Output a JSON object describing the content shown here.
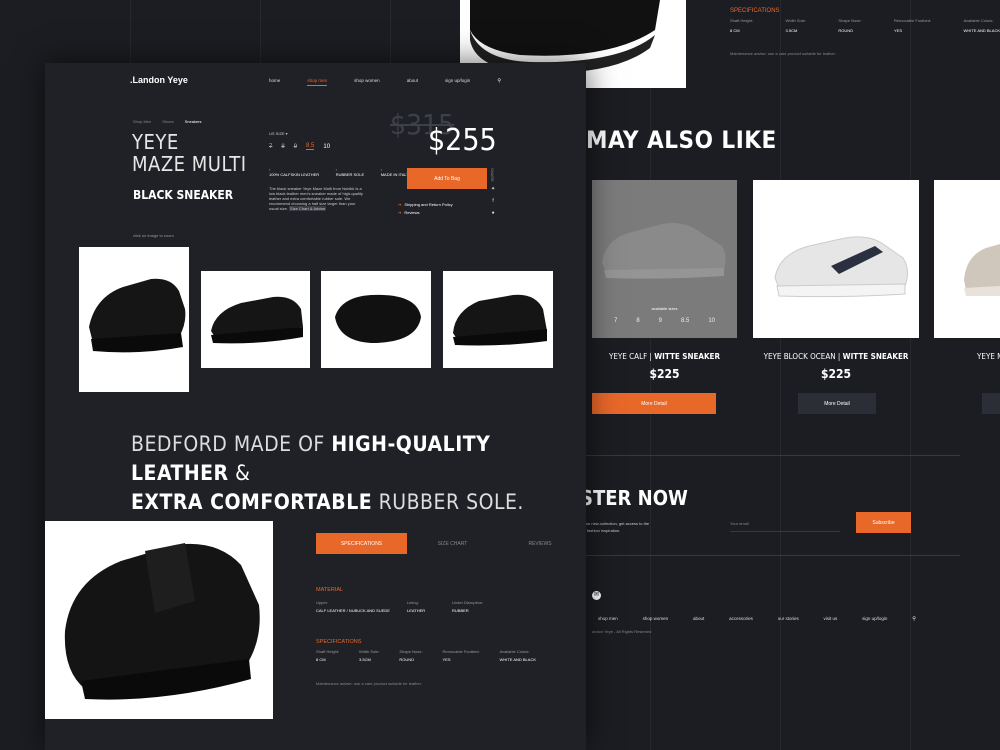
{
  "brand": ".Landon Yeye",
  "nav": {
    "home": "home",
    "shop_men": "shop men",
    "shop_women": "shop women",
    "about": "about",
    "signup": "sign up/login"
  },
  "breadcrumb": [
    "Shop Men",
    "Shoes",
    "Sneakers"
  ],
  "product": {
    "title_line1": "YEYE",
    "title_line2": "MAZE MULTI",
    "subtitle": "BLACK SNEAKER",
    "old_price": "$315",
    "price": "$255",
    "size_label": "US SIZE",
    "sizes": [
      "7",
      "8",
      "9",
      "8.5",
      "10"
    ],
    "features": [
      "100% CALFSKIN LEATHER",
      "RUBBER SOLE",
      "MADE IN ITALY"
    ],
    "description": "The black sneaker Yeye Maze Multi from Nubikk is a low black leather men's sneaker made of high-quality leather and extra comfortable rubber sole.",
    "size_advice": "We recommend choosing a half size larger than your usual size.",
    "size_chart_link": "Size Chart & Advise",
    "add_to_bag": "Add To Bag",
    "shipping_link": "Shipping and Return Policy",
    "reviews_link": "Reviews",
    "share_label": "SHARE",
    "zoom_hint": "click on image to zoom"
  },
  "headline": {
    "l1a": "BEDFORD MADE OF ",
    "l1b": "HIGH-QUALITY LEATHER",
    "l1c": " &",
    "l2a": "EXTRA COMFORTABLE",
    "l2b": " RUBBER SOLE."
  },
  "tabs": [
    "SPECIFICATIONS",
    "SIZE CHART",
    "REVIEWS"
  ],
  "material": {
    "title": "MATERIAL",
    "labels": [
      "Upper:",
      "Lining:",
      "Under Disruption:"
    ],
    "values": [
      "CALF LEATHER / NUBUCK AND SUEDE",
      "LEATHER",
      "RUBBER"
    ]
  },
  "specs": {
    "title": "SPECIFICATIONS",
    "labels": [
      "Shaft Height:",
      "Width Sole:",
      "Shape Nose:",
      "Removable Footbed:",
      "Available Colors:"
    ],
    "values": [
      "8 CM",
      "3.5CM",
      "ROUND",
      "YES",
      "WHITE AND BLACK"
    ]
  },
  "maintenance": "Maintenance advise: use a care product suitable for leather.",
  "also_like": {
    "title": "MAY ALSO LIKE",
    "items": [
      {
        "name_a": "YEYE CALF | ",
        "name_b": "WITTE SNEAKER",
        "price": "$225",
        "button": "More Detail",
        "available": "available sizes",
        "sizes": [
          "7",
          "8",
          "9",
          "8.5",
          "10"
        ]
      },
      {
        "name_a": "YEYE BLOCK OCEAN | ",
        "name_b": "WITTE SNEAKER",
        "price": "$225",
        "button": "More Detail"
      },
      {
        "name_a": "YEYE M",
        "name_b": "",
        "price": "",
        "button": ""
      }
    ]
  },
  "register": {
    "title": "STER NOW",
    "text1": "ut our new-collection, get access to the",
    "text2": "fashion inspiration.",
    "placeholder": "Your email",
    "button": "Subscribe"
  },
  "footer": {
    "links": [
      "shop men",
      "shop women",
      "about",
      "accessories",
      "our stories",
      "visit us",
      "sign up/login"
    ],
    "copyright": "andon Yeye - All Rights Reserved"
  },
  "colors": {
    "accent": "#e8682a",
    "background": "#1c1d22",
    "panel": "#1f2127"
  }
}
